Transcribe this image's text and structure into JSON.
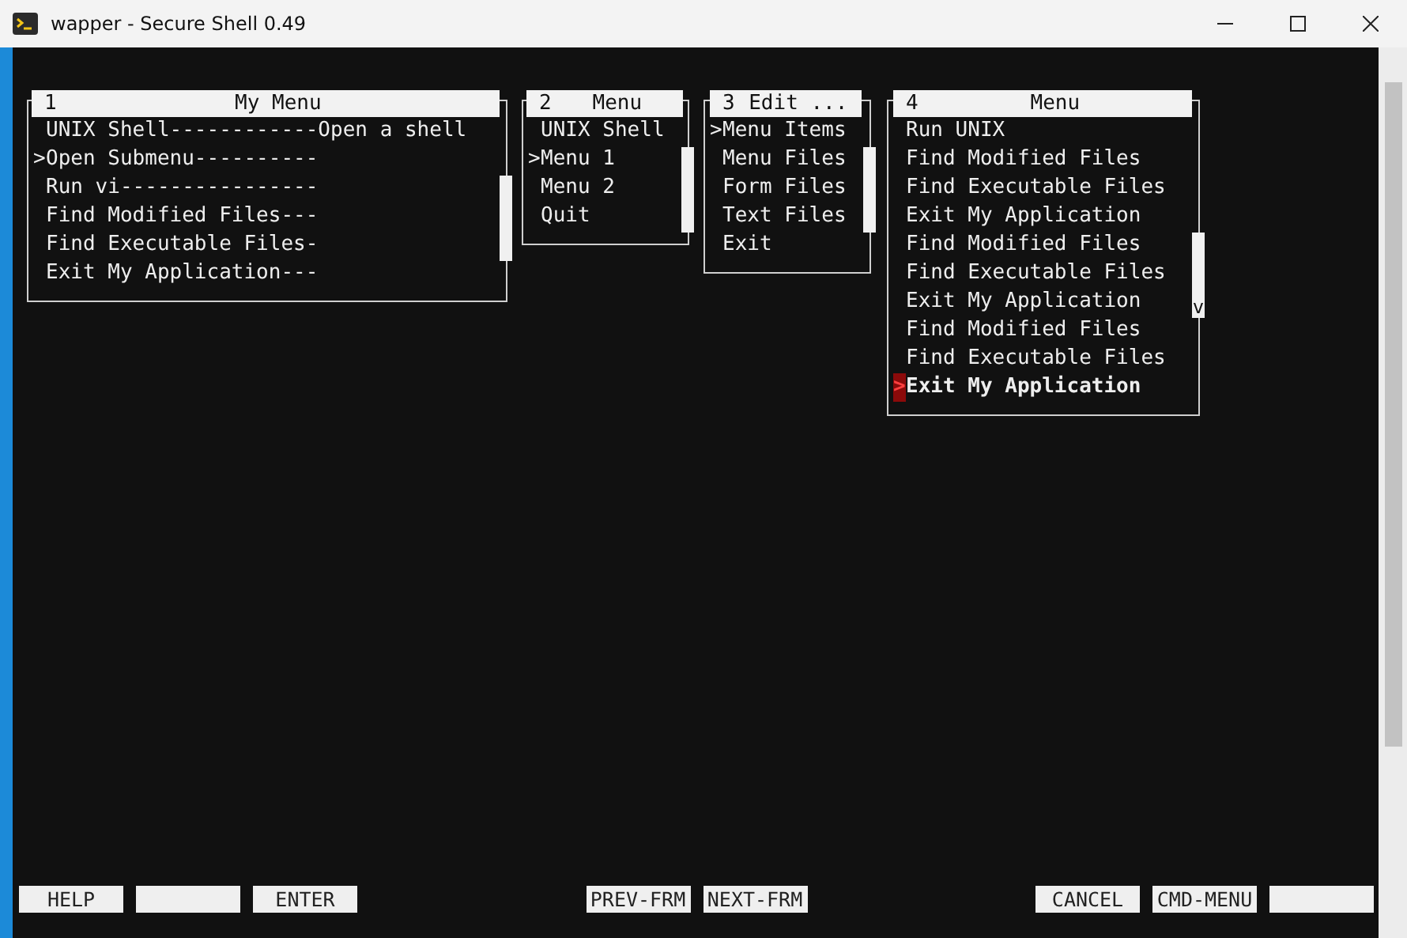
{
  "window": {
    "title": "wapper - Secure Shell 0.49"
  },
  "menus": [
    {
      "number": "1",
      "heading": "My Menu",
      "pointer": ">",
      "active": false,
      "items": [
        {
          "label": "UNIX Shell------------Open a shell",
          "selected": false
        },
        {
          "label": "Open Submenu----------",
          "selected": true
        },
        {
          "label": "Run vi----------------",
          "selected": false
        },
        {
          "label": "Find Modified Files---",
          "selected": false
        },
        {
          "label": "Find Executable Files-",
          "selected": false
        },
        {
          "label": "Exit My Application---",
          "selected": false
        }
      ]
    },
    {
      "number": "2",
      "heading": "Menu",
      "pointer": ">",
      "active": false,
      "items": [
        {
          "label": "UNIX Shell",
          "selected": false
        },
        {
          "label": "Menu 1",
          "selected": true
        },
        {
          "label": "Menu 2",
          "selected": false
        },
        {
          "label": "Quit",
          "selected": false
        }
      ]
    },
    {
      "number": "3",
      "heading": "Edit ...",
      "pointer": ">",
      "active": false,
      "items": [
        {
          "label": "Menu Items",
          "selected": true
        },
        {
          "label": "Menu Files",
          "selected": false
        },
        {
          "label": "Form Files",
          "selected": false
        },
        {
          "label": "Text Files",
          "selected": false
        },
        {
          "label": "Exit",
          "selected": false
        }
      ]
    },
    {
      "number": "4",
      "heading": "Menu",
      "pointer": ">",
      "active": true,
      "scroll_mark": "v",
      "items": [
        {
          "label": "Run UNIX",
          "selected": false
        },
        {
          "label": "Find Modified Files",
          "selected": false
        },
        {
          "label": "Find Executable Files",
          "selected": false
        },
        {
          "label": "Exit My Application",
          "selected": false
        },
        {
          "label": "Find Modified Files",
          "selected": false
        },
        {
          "label": "Find Executable Files",
          "selected": false
        },
        {
          "label": "Exit My Application",
          "selected": false
        },
        {
          "label": "Find Modified Files",
          "selected": false
        },
        {
          "label": "Find Executable Files",
          "selected": false
        },
        {
          "label": "Exit My Application",
          "selected": true
        }
      ]
    }
  ],
  "function_keys": {
    "left": [
      {
        "kind": "label",
        "label": "HELP"
      },
      {
        "kind": "blank"
      },
      {
        "kind": "label",
        "label": "ENTER"
      }
    ],
    "middle": [
      {
        "kind": "label",
        "label": "PREV-FRM"
      },
      {
        "kind": "label",
        "label": "NEXT-FRM"
      }
    ],
    "right": [
      {
        "kind": "label",
        "label": "CANCEL"
      },
      {
        "kind": "label",
        "label": "CMD-MENU"
      },
      {
        "kind": "blank"
      }
    ]
  }
}
